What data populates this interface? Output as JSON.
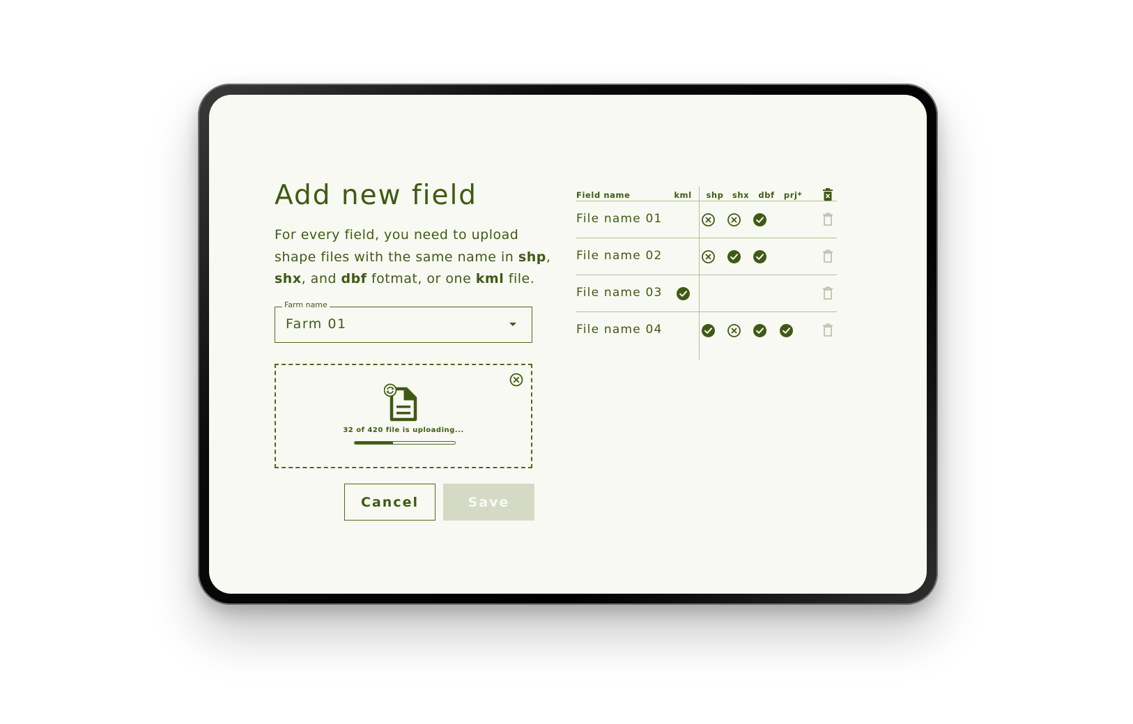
{
  "page": {
    "title": "Add new field",
    "description": {
      "p1": "For every field, you need to upload shape files with the same name in ",
      "b1": "shp",
      "p2": ", ",
      "b2": "shx",
      "p3": ", and ",
      "b3": "dbf",
      "p4": " fotmat, or one ",
      "b4": "kml",
      "p5": " file."
    }
  },
  "farm_select": {
    "label": "Farm name",
    "value": "Farm 01"
  },
  "upload": {
    "status_text": "32 of 420 file is uploading...",
    "uploaded": 32,
    "total": 420,
    "progress_percent": 38
  },
  "buttons": {
    "cancel": "Cancel",
    "save": "Save"
  },
  "table": {
    "headers": {
      "name": "Field name",
      "kml": "kml",
      "shp": "shp",
      "shx": "shx",
      "dbf": "dbf",
      "prj": "prj*"
    },
    "rows": [
      {
        "name": "File name 01",
        "kml": "none",
        "shp": "error",
        "shx": "error",
        "dbf": "ok",
        "prj": "none"
      },
      {
        "name": "File name 02",
        "kml": "none",
        "shp": "error",
        "shx": "ok",
        "dbf": "ok",
        "prj": "none"
      },
      {
        "name": "File name 03",
        "kml": "ok",
        "shp": "none",
        "shx": "none",
        "dbf": "none",
        "prj": "none"
      },
      {
        "name": "File name 04",
        "kml": "none",
        "shp": "ok",
        "shx": "error",
        "dbf": "ok",
        "prj": "ok"
      }
    ]
  },
  "colors": {
    "primary": "#3f5a14",
    "screen_background": "#f8f9f2",
    "divider": "#b3bf95",
    "disabled_button": "#d4dac3",
    "disabled_icon": "#b8bba8"
  },
  "icons": {
    "ok": "check-circle-icon",
    "error": "x-circle-icon",
    "delete": "trash-icon",
    "delete_all": "trash-x-icon",
    "file": "document-sync-icon",
    "close": "close-circle-icon",
    "dropdown": "chevron-down-icon"
  }
}
